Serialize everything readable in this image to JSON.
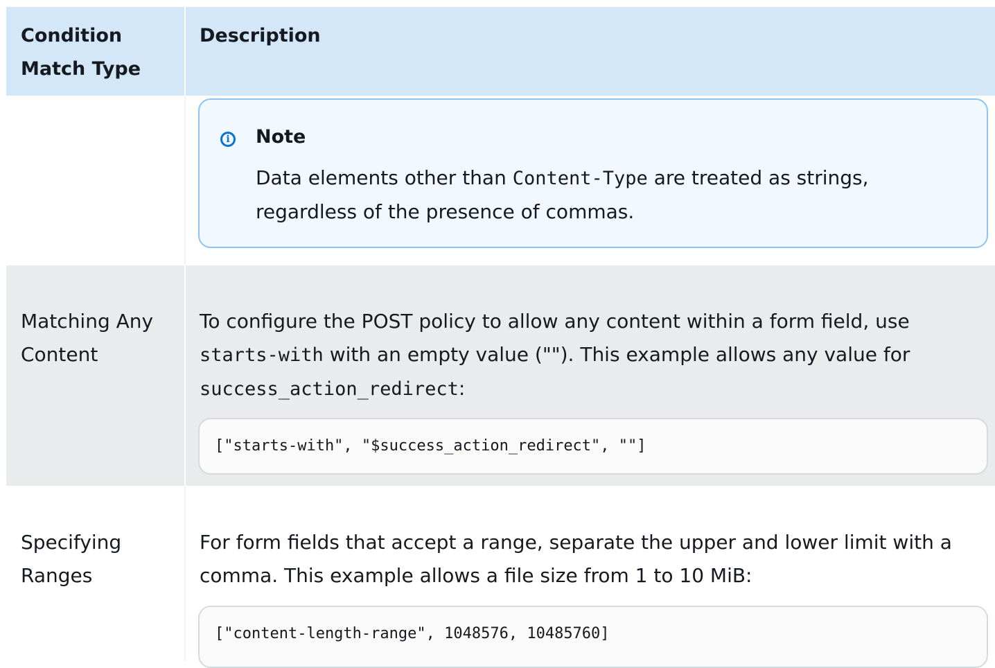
{
  "table": {
    "headers": {
      "col1": "Condition Match Type",
      "col2": "Description"
    },
    "rows": [
      {
        "label": "",
        "note": {
          "title": "Note",
          "text_before": "Data elements other than ",
          "code": "Content-Type",
          "text_after": " are treated as strings, regardless of the presence of commas."
        }
      },
      {
        "label": "Matching Any Content",
        "desc_part1": "To configure the POST policy to allow any content within a form field, use ",
        "desc_code1": "starts-with",
        "desc_part2": " with an empty value (\"\"). This example allows any value for ",
        "desc_code2": "success_action_redirect",
        "desc_part3": ":",
        "code_block": "[\"starts-with\", \"$success_action_redirect\", \"\"]"
      },
      {
        "label": "Specifying Ranges",
        "desc": "For form fields that accept a range, separate the upper and lower limit with a comma. This example allows a file size from 1 to 10 MiB:",
        "code_block": "[\"content-length-range\", 1048576, 10485760]"
      }
    ]
  },
  "colors": {
    "header_bg": "#d4e7f8",
    "note_border": "#8fc3ef",
    "note_icon": "#0972d3",
    "row_alt_bg": "#e9ebed"
  },
  "icons": {
    "note": "info-icon"
  }
}
